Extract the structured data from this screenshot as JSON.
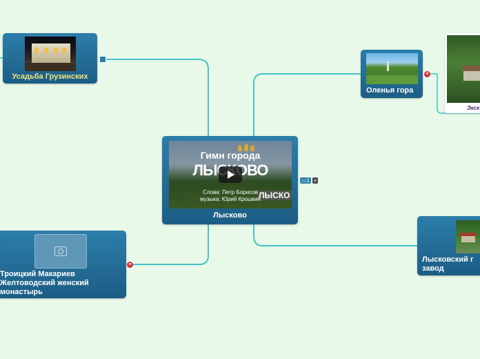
{
  "center": {
    "label": "Лысково",
    "video": {
      "title_line1": "Гимн города",
      "title_line2": "ЛЫСКОВО",
      "credit_line1": "Слова: Петр Борисов",
      "credit_line2": "музыка: Юрий Крошкин",
      "sign_text": "ЛЫСКО"
    },
    "badge_count": "1"
  },
  "nodes": {
    "usadba": {
      "label": "Усадьба Грузинских"
    },
    "olenya": {
      "label": "Оленья гора"
    },
    "ekskursii": {
      "label": "Экск"
    },
    "monastyr": {
      "lines": [
        "Троицкий Макариев",
        "Желтоводский женский",
        "монастырь"
      ]
    },
    "zavod": {
      "lines": [
        "Лысковский г",
        "завод"
      ]
    }
  },
  "colors": {
    "background": "#e8f8e9",
    "link": "#43c4c8",
    "node_top": "#2c7eaa",
    "node_bottom": "#1c5d85",
    "usadba_text": "#f2e37a"
  }
}
